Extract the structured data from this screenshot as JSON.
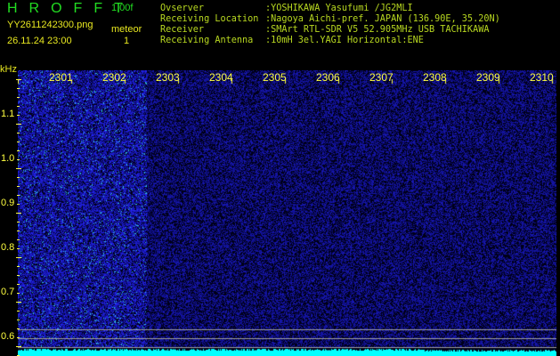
{
  "header": {
    "logo": "HROFFT",
    "version": "1.00f",
    "filename": "YY2611242300.png",
    "datetime": "26.11.24 23:00",
    "meteor_label": "meteor",
    "meteor_count": "1"
  },
  "info": [
    {
      "label": "Ovserver",
      "value": ":YOSHIKAWA Yasufumi /JG2MLI"
    },
    {
      "label": "Receiving Location",
      "value": ":Nagoya Aichi-pref. JAPAN (136.90E, 35.20N)"
    },
    {
      "label": "Receiver",
      "value": ":SMArt RTL-SDR V5 52.905MHz USB TACHIKAWA"
    },
    {
      "label": "Receiving Antenna",
      "value": ":10mH 3el.YAGI Horizontal:ENE"
    }
  ],
  "axis": {
    "y_unit": "kHz",
    "x_labels": [
      "2301",
      "2302",
      "2303",
      "2304",
      "2305",
      "2306",
      "2307",
      "2308",
      "2309",
      "2310"
    ],
    "y_labels": [
      "1.1",
      "1.0",
      "0.9",
      "0.8",
      "0.7",
      "0.6"
    ]
  },
  "colors": {
    "text": "#ffff40",
    "logo": "#22dd22",
    "noise": "#1a1acc",
    "floor": "#00ffff"
  }
}
